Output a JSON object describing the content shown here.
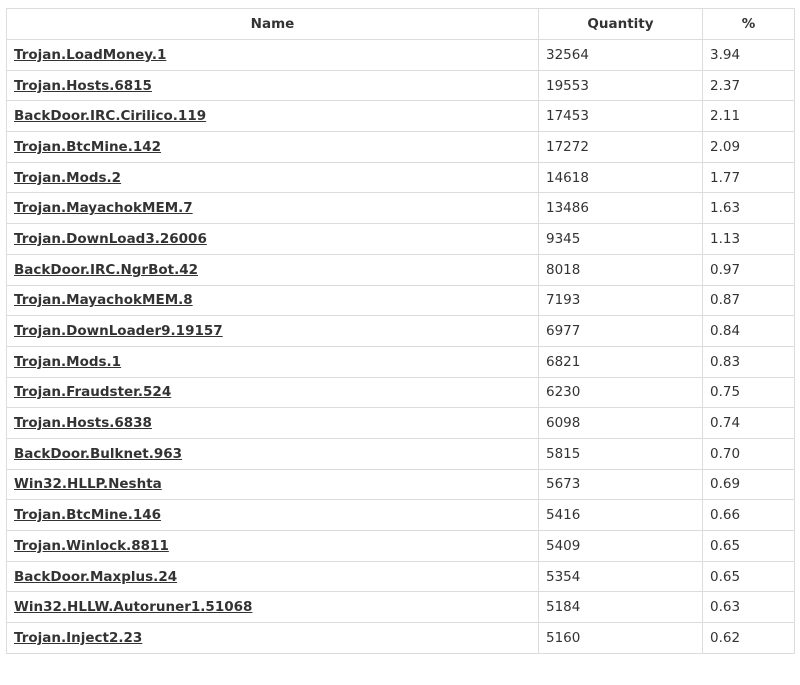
{
  "table": {
    "headers": {
      "name": "Name",
      "quantity": "Quantity",
      "percent": "%"
    },
    "rows": [
      {
        "name": "Trojan.LoadMoney.1",
        "quantity": "32564",
        "percent": "3.94"
      },
      {
        "name": "Trojan.Hosts.6815",
        "quantity": "19553",
        "percent": "2.37"
      },
      {
        "name": "BackDoor.IRC.Cirilico.119",
        "quantity": "17453",
        "percent": "2.11"
      },
      {
        "name": "Trojan.BtcMine.142",
        "quantity": "17272",
        "percent": "2.09"
      },
      {
        "name": "Trojan.Mods.2",
        "quantity": "14618",
        "percent": "1.77"
      },
      {
        "name": "Trojan.MayachokMEM.7",
        "quantity": "13486",
        "percent": "1.63"
      },
      {
        "name": "Trojan.DownLoad3.26006",
        "quantity": "9345",
        "percent": "1.13"
      },
      {
        "name": "BackDoor.IRC.NgrBot.42",
        "quantity": "8018",
        "percent": "0.97"
      },
      {
        "name": "Trojan.MayachokMEM.8",
        "quantity": "7193",
        "percent": "0.87"
      },
      {
        "name": "Trojan.DownLoader9.19157",
        "quantity": "6977",
        "percent": "0.84"
      },
      {
        "name": "Trojan.Mods.1",
        "quantity": "6821",
        "percent": "0.83"
      },
      {
        "name": "Trojan.Fraudster.524",
        "quantity": "6230",
        "percent": "0.75"
      },
      {
        "name": "Trojan.Hosts.6838",
        "quantity": "6098",
        "percent": "0.74"
      },
      {
        "name": "BackDoor.Bulknet.963",
        "quantity": "5815",
        "percent": "0.70"
      },
      {
        "name": "Win32.HLLP.Neshta",
        "quantity": "5673",
        "percent": "0.69"
      },
      {
        "name": "Trojan.BtcMine.146",
        "quantity": "5416",
        "percent": "0.66"
      },
      {
        "name": "Trojan.Winlock.8811",
        "quantity": "5409",
        "percent": "0.65"
      },
      {
        "name": "BackDoor.Maxplus.24",
        "quantity": "5354",
        "percent": "0.65"
      },
      {
        "name": "Win32.HLLW.Autoruner1.51068",
        "quantity": "5184",
        "percent": "0.63"
      },
      {
        "name": "Trojan.Inject2.23",
        "quantity": "5160",
        "percent": "0.62"
      }
    ]
  }
}
